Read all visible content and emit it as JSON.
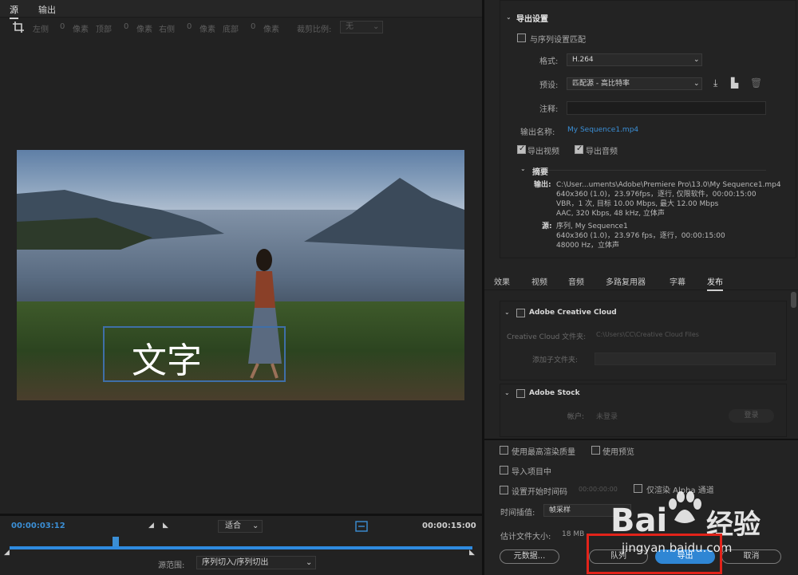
{
  "source_panel": {
    "tabs": [
      "源",
      "输出"
    ],
    "crop": {
      "left_label": "左侧",
      "left_value": "0",
      "unit": "像素",
      "top_label": "顶部",
      "top_value": "0",
      "right_label": "右侧",
      "right_value": "0",
      "bottom_label": "底部",
      "bottom_value": "0",
      "ratio_label": "裁剪比例:",
      "ratio_value": "无"
    },
    "overlay_text": "文字",
    "timecode_current": "00:00:03:12",
    "timecode_end": "00:00:15:00",
    "fit_value": "适合",
    "playhead_progress": 0.23,
    "range_label": "源范围:",
    "range_value": "序列切入/序列切出"
  },
  "export_settings": {
    "title": "导出设置",
    "match_sequence_label": "与序列设置匹配",
    "format_label": "格式:",
    "format_value": "H.264",
    "preset_label": "预设:",
    "preset_value": "匹配源 - 高比特率",
    "comment_label": "注释:",
    "output_name_label": "输出名称:",
    "output_name_value": "My Sequence1.mp4",
    "export_video_label": "导出视频",
    "export_audio_label": "导出音频",
    "summary_title": "摘要",
    "output_label": "输出:",
    "output_lines": [
      "C:\\User...uments\\Adobe\\Premiere Pro\\13.0\\My Sequence1.mp4",
      "640x360 (1.0)，23.976fps，逐行, 仅限软件，00:00:15:00",
      "VBR，1 次, 目标 10.00 Mbps, 最大 12.00 Mbps",
      "AAC, 320 Kbps, 48  kHz, 立体声"
    ],
    "source_label": "源:",
    "source_lines": [
      "序列, My Sequence1",
      "640x360 (1.0)，23.976 fps，逐行，00:00:15:00",
      "48000 Hz，立体声"
    ]
  },
  "publish": {
    "tabs": [
      "效果",
      "视频",
      "音频",
      "多路复用器",
      "字幕",
      "发布"
    ],
    "cc_title": "Adobe Creative Cloud",
    "cc_folder_label": "Creative Cloud 文件夹:",
    "cc_folder_value": "C:\\Users\\CC\\Creative Cloud Files",
    "cc_subfolder_label": "添加子文件夹:",
    "stock_title": "Adobe Stock",
    "account_label": "帐户:",
    "account_value": "未登录",
    "login_label": "登录"
  },
  "bottom": {
    "max_quality_label": "使用最高渲染质量",
    "use_previews_label": "使用预览",
    "import_project_label": "导入项目中",
    "set_timecode_label": "设置开始时间码",
    "timecode_value": "00:00:00:00",
    "alpha_only_label": "仅渲染 Alpha 通道",
    "interp_label": "时间插值:",
    "interp_value": "帧采样",
    "file_size_label": "估计文件大小:",
    "file_size_value": "18 MB",
    "metadata_btn": "元数据...",
    "queue_btn": "队列",
    "export_btn": "导出",
    "cancel_btn": "取消"
  },
  "watermark": {
    "brand": "Bai",
    "brand_cn": "经验",
    "url": "jingyan.baidu.com"
  }
}
